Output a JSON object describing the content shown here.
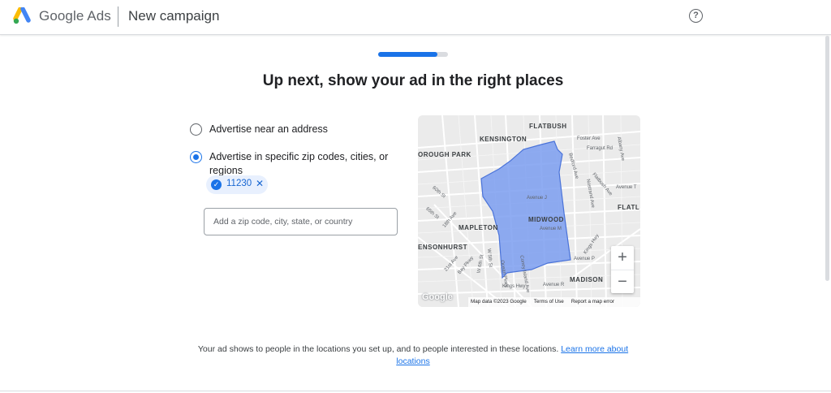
{
  "header": {
    "brand": "Google Ads",
    "page_title": "New campaign",
    "help_icon": "help-circle-icon"
  },
  "progress": {
    "fraction": 0.85
  },
  "headline": "Up next, show your ad in the right places",
  "location_options": [
    {
      "label": "Advertise near an address",
      "selected": false
    },
    {
      "label": "Advertise in specific zip codes, cities, or regions",
      "selected": true
    }
  ],
  "selected_locations": [
    {
      "label": "11230"
    }
  ],
  "location_input": {
    "placeholder": "Add a zip code, city, state, or country",
    "value": ""
  },
  "map": {
    "area_labels": {
      "flatbush": "FLATBUSH",
      "kensington": "KENSINGTON",
      "borough_park": "OROUGH PARK",
      "mapleton": "MAPLETON",
      "midwood": "MIDWOOD",
      "bensonhurst": "ENSONHURST",
      "madison": "MADISON",
      "flatlands": "FLATL"
    },
    "street_labels": {
      "foster_ave": "Foster Ave",
      "farragut_rd": "Farragut Rd",
      "avenue_j": "Avenue J",
      "avenue_m": "Avenue M",
      "avenue_p": "Avenue P",
      "avenue_r": "Avenue R",
      "avenue_t": "Avenue T",
      "kings_hwy": "Kings Hwy",
      "ocean_pkwy": "Ocean Pkwy",
      "coney_island_ave": "Coney Island Ave",
      "bedford_ave": "Bedford Ave",
      "nostrand_ave": "Nostrand Ave",
      "flatbush_ave": "Flatbush Ave",
      "60th_st": "60th St",
      "65th_st": "65th St",
      "18th_ave": "18th Ave",
      "21st_ave": "21st Ave",
      "bay_pkwy": "Bay Pkwy",
      "w_6th_st": "W 6th St",
      "w_5th_st": "W 5th St",
      "albany_ave": "Albany Ave",
      "kings_hwy_2": "Kings Hwy"
    },
    "zoom_in": "+",
    "zoom_out": "−",
    "google_mark": "Google",
    "attribution": {
      "map_data": "Map data ©2023 Google",
      "terms": "Terms of Use",
      "report": "Report a map error"
    },
    "highlight_color": "#7b9ef0"
  },
  "footer": {
    "text": "Your ad shows to people in the locations you set up, and to people interested in these locations. ",
    "link": "Learn more about locations"
  },
  "colors": {
    "accent": "#1a73e8",
    "brand_blue": "#4285f4",
    "brand_yellow": "#fbbc04",
    "brand_green": "#34a853"
  }
}
